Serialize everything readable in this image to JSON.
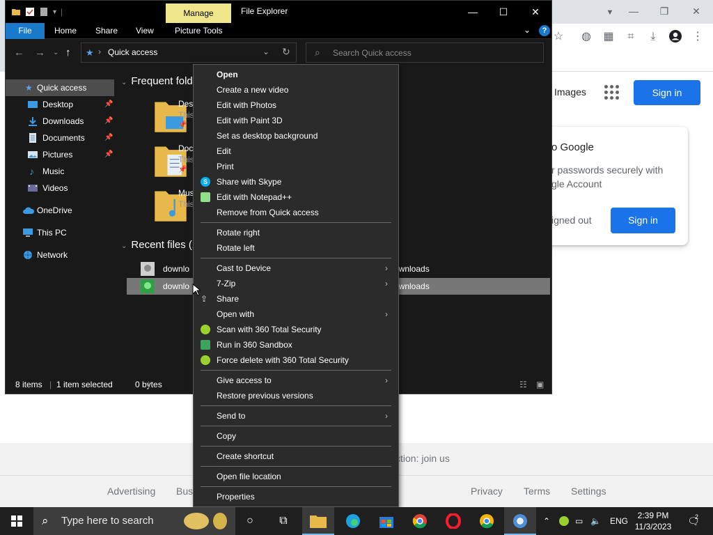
{
  "explorer": {
    "title": "File Explorer",
    "manage_tab": "Manage",
    "ribbon": {
      "file": "File",
      "home": "Home",
      "share": "Share",
      "view": "View",
      "picture_tools": "Picture Tools",
      "help": "?"
    },
    "address": "Quick access",
    "search_placeholder": "Search Quick access",
    "sidebar": [
      {
        "label": "Quick access"
      },
      {
        "label": "Desktop"
      },
      {
        "label": "Downloads"
      },
      {
        "label": "Documents"
      },
      {
        "label": "Pictures"
      },
      {
        "label": "Music"
      },
      {
        "label": "Videos"
      },
      {
        "label": "OneDrive"
      },
      {
        "label": "This PC"
      },
      {
        "label": "Network"
      }
    ],
    "frequent_header": "Frequent fold",
    "frequent": [
      {
        "name": "Desk",
        "sub": "This"
      },
      {
        "name": "Doc",
        "sub": "This"
      },
      {
        "name": "Mus",
        "sub": "This"
      }
    ],
    "recent_header": "Recent files (2",
    "recent": [
      {
        "name": "downlo",
        "path": "ownloads"
      },
      {
        "name": "downlo",
        "path": "ownloads"
      }
    ],
    "status": {
      "items": "8 items",
      "selected": "1 item selected",
      "size": "0 bytes"
    }
  },
  "context_menu": {
    "items": [
      {
        "label": "Open"
      },
      {
        "label": "Create a new video"
      },
      {
        "label": "Edit with Photos"
      },
      {
        "label": "Edit with Paint 3D"
      },
      {
        "label": "Set as desktop background"
      },
      {
        "label": "Edit"
      },
      {
        "label": "Print"
      },
      {
        "label": "Share with Skype"
      },
      {
        "label": "Edit with Notepad++"
      },
      {
        "label": "Remove from Quick access"
      },
      {
        "label": "Rotate right"
      },
      {
        "label": "Rotate left"
      },
      {
        "label": "Cast to Device"
      },
      {
        "label": "7-Zip"
      },
      {
        "label": "Share"
      },
      {
        "label": "Open with"
      },
      {
        "label": "Scan with 360 Total Security"
      },
      {
        "label": "Run in 360 Sandbox"
      },
      {
        "label": "Force delete with 360 Total Security"
      },
      {
        "label": "Give access to"
      },
      {
        "label": "Restore previous versions"
      },
      {
        "label": "Send to"
      },
      {
        "label": "Copy"
      },
      {
        "label": "Create shortcut"
      },
      {
        "label": "Open file location"
      },
      {
        "label": "Properties"
      }
    ]
  },
  "google": {
    "images": "Images",
    "sign_in": "Sign in",
    "card_title": "o Google",
    "card_desc": "r passwords securely with gle Account",
    "card_signed_out": "igned out",
    "card_sign_in": "Sign in",
    "carbon": "ction: join us",
    "footer": {
      "advertising": "Advertising",
      "business": "Bus",
      "privacy": "Privacy",
      "terms": "Terms",
      "settings": "Settings"
    }
  },
  "taskbar": {
    "search_placeholder": "Type here to search",
    "language": "ENG",
    "time": "2:39 PM",
    "date": "11/3/2023",
    "notification_count": "2"
  },
  "colors": {
    "accent_blue": "#1979ca",
    "google_blue": "#1a73e8",
    "manage_tab": "#f0e68c"
  }
}
